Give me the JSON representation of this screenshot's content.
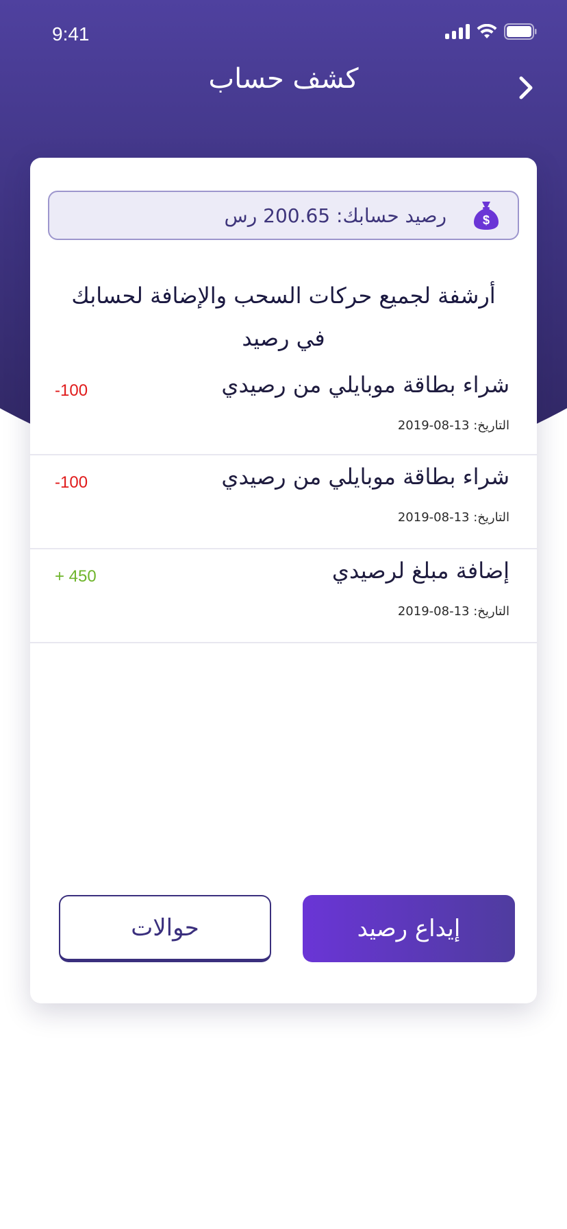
{
  "status_bar": {
    "time": "9:41"
  },
  "header": {
    "title": "كشف حساب"
  },
  "balance": {
    "text": "رصيد حسابك: 200.65 رس"
  },
  "description": "أرشفة لجميع حركات السحب والإضافة لحسابك في رصيد",
  "transactions": [
    {
      "title": "شراء بطاقة موبايلي من رصيدي",
      "date": "التاريخ: 13-08-2019",
      "amount": "-100",
      "amount_color": "#e01b1b"
    },
    {
      "title": "شراء بطاقة موبايلي من رصيدي",
      "date": "التاريخ: 13-08-2019",
      "amount": "-100",
      "amount_color": "#e01b1b"
    },
    {
      "title": "إضافة مبلغ لرصيدي",
      "date": "التاريخ: 13-08-2019",
      "amount": "+ 450",
      "amount_color": "#6fb52c"
    }
  ],
  "actions": {
    "deposit_label": "إيداع رصيد",
    "transfers_label": "حوالات"
  },
  "colors": {
    "header": "#4f419f",
    "accent": "#6a35d6",
    "negative": "#e01b1b",
    "positive": "#6fb52c"
  },
  "icons": {
    "back": "chevron-right-icon",
    "balance": "money-bag-icon"
  }
}
